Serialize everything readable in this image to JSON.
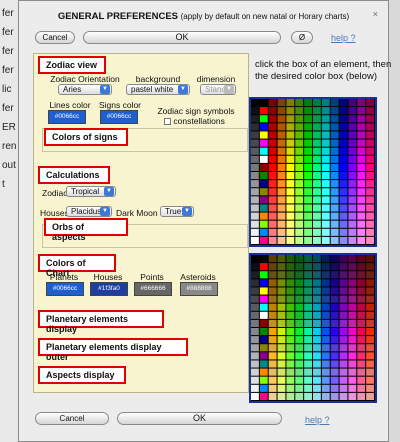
{
  "background_app": {
    "lines": [
      "fer",
      "fer",
      "fer",
      "fer",
      "lic",
      "fer",
      "ER",
      "ren",
      "out",
      "t"
    ]
  },
  "dialog": {
    "title": "GENERAL PREFERENCES",
    "subtitle": "(apply by default on new natal or Horary charts)",
    "close_label": "×",
    "top_buttons": {
      "cancel": "Cancel",
      "ok": "OK",
      "reset": "Ø",
      "help": "help ?"
    },
    "bottom_buttons": {
      "cancel": "Cancel",
      "ok": "OK",
      "help": "help ?"
    },
    "help_text": "click the box of an element, then the desired color box (below)"
  },
  "zodiac_view": {
    "heading": "Zodiac view",
    "orientation_label": "Zodiac Orientation",
    "orientation_value": "Aries",
    "background_label": "background",
    "background_value": "pastel white",
    "dimension_label": "dimension",
    "dimension_value": "Stanc",
    "lines_color_label": "Lines color",
    "lines_color_value": "#0066cc",
    "signs_color_label": "Signs color",
    "signs_color_value": "#0066cc",
    "symbols_label": "Zodiac sign symbols",
    "constellations_label": "constellations",
    "colors_of_signs": "Colors of signs"
  },
  "calculations": {
    "heading": "Calculations",
    "zodiac_label": "Zodiac",
    "zodiac_value": "Tropical",
    "houses_label": "Houses",
    "houses_value": "Placidus",
    "dark_moon_label": "Dark Moon",
    "dark_moon_value": "True",
    "orbs_of_aspects": "Orbs of aspects"
  },
  "colors_of_chart": {
    "heading": "Colors of Chart",
    "planets_label": "Planets",
    "planets_value": "#0066cc",
    "houses_label": "Houses",
    "houses_value": "#1f3fa0",
    "points_label": "Points",
    "points_value": "#666666",
    "asteroids_label": "Asteroids",
    "asteroids_value": "#888888"
  },
  "sections": {
    "planetary_elements": "Planetary elements display",
    "planetary_elements_outer": "Planetary elements display outer",
    "aspects_display": "Aspects display"
  },
  "colors": {
    "panel_bg": "#f7f4cf",
    "highlight_border": "#e00000",
    "palette_border": "#1a2f9a",
    "lines_swatch": "#1d5fd0",
    "signs_swatch": "#1d5fd0",
    "planets_swatch": "#1d5fd0",
    "houses_swatch": "#1f3fa0",
    "points_swatch": "#666666",
    "asteroids_swatch": "#888888"
  }
}
